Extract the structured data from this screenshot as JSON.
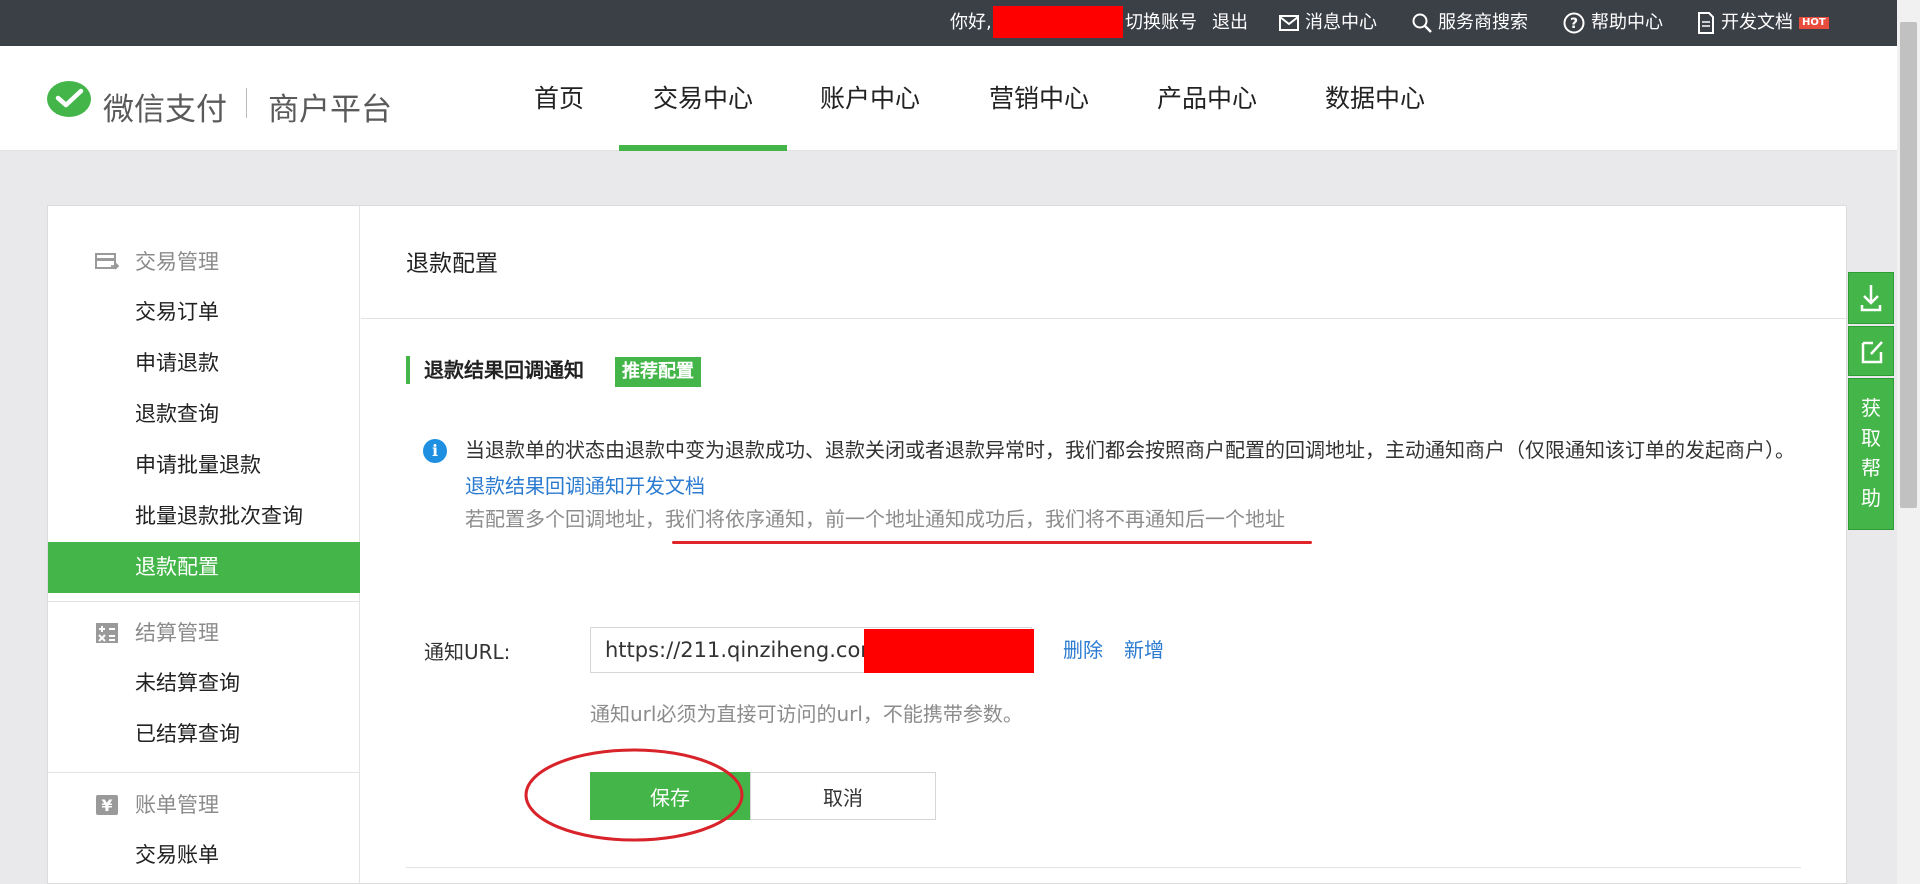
{
  "topbar": {
    "greeting": "你好,",
    "switch_account": "切换账号",
    "logout": "退出",
    "messages": "消息中心",
    "provider_search": "服务商搜索",
    "help": "帮助中心",
    "dev_docs": "开发文档",
    "hot_badge": "HOT"
  },
  "brand": {
    "name": "微信支付",
    "subtitle": "商户平台",
    "color": "#44b549"
  },
  "nav": {
    "items": [
      "首页",
      "交易中心",
      "账户中心",
      "营销中心",
      "产品中心",
      "数据中心"
    ],
    "active": "交易中心"
  },
  "sidebar": {
    "groups": [
      {
        "title": "交易管理",
        "icon": "card-icon",
        "items": [
          "交易订单",
          "申请退款",
          "退款查询",
          "申请批量退款",
          "批量退款批次查询",
          "退款配置"
        ]
      },
      {
        "title": "结算管理",
        "icon": "calculator-icon",
        "items": [
          "未结算查询",
          "已结算查询"
        ]
      },
      {
        "title": "账单管理",
        "icon": "yen-icon",
        "items": [
          "交易账单"
        ]
      }
    ],
    "active_item": "退款配置"
  },
  "main": {
    "title": "退款配置",
    "section_title": "退款结果回调通知",
    "badge": "推荐配置",
    "info_text": "当退款单的状态由退款中变为退款成功、退款关闭或者退款异常时，我们都会按照商户配置的回调地址，主动通知商户（仅限通知该订单的发起商户）。",
    "info_link": "退款结果回调通知开发文档",
    "info_sub_prefix": "若配置多个回调地址，",
    "info_sub_highlight": "我们将依序通知，前一个地址通知成功后，我们将不再通知后一个地址",
    "url_label": "通知URL:",
    "url_value": "https://211.qinziheng.com",
    "delete": "删除",
    "add": "新增",
    "hint": "通知url必须为直接可访问的url，不能携带参数。",
    "save": "保存",
    "cancel": "取消"
  },
  "float_help": [
    "获",
    "取",
    "帮",
    "助"
  ]
}
